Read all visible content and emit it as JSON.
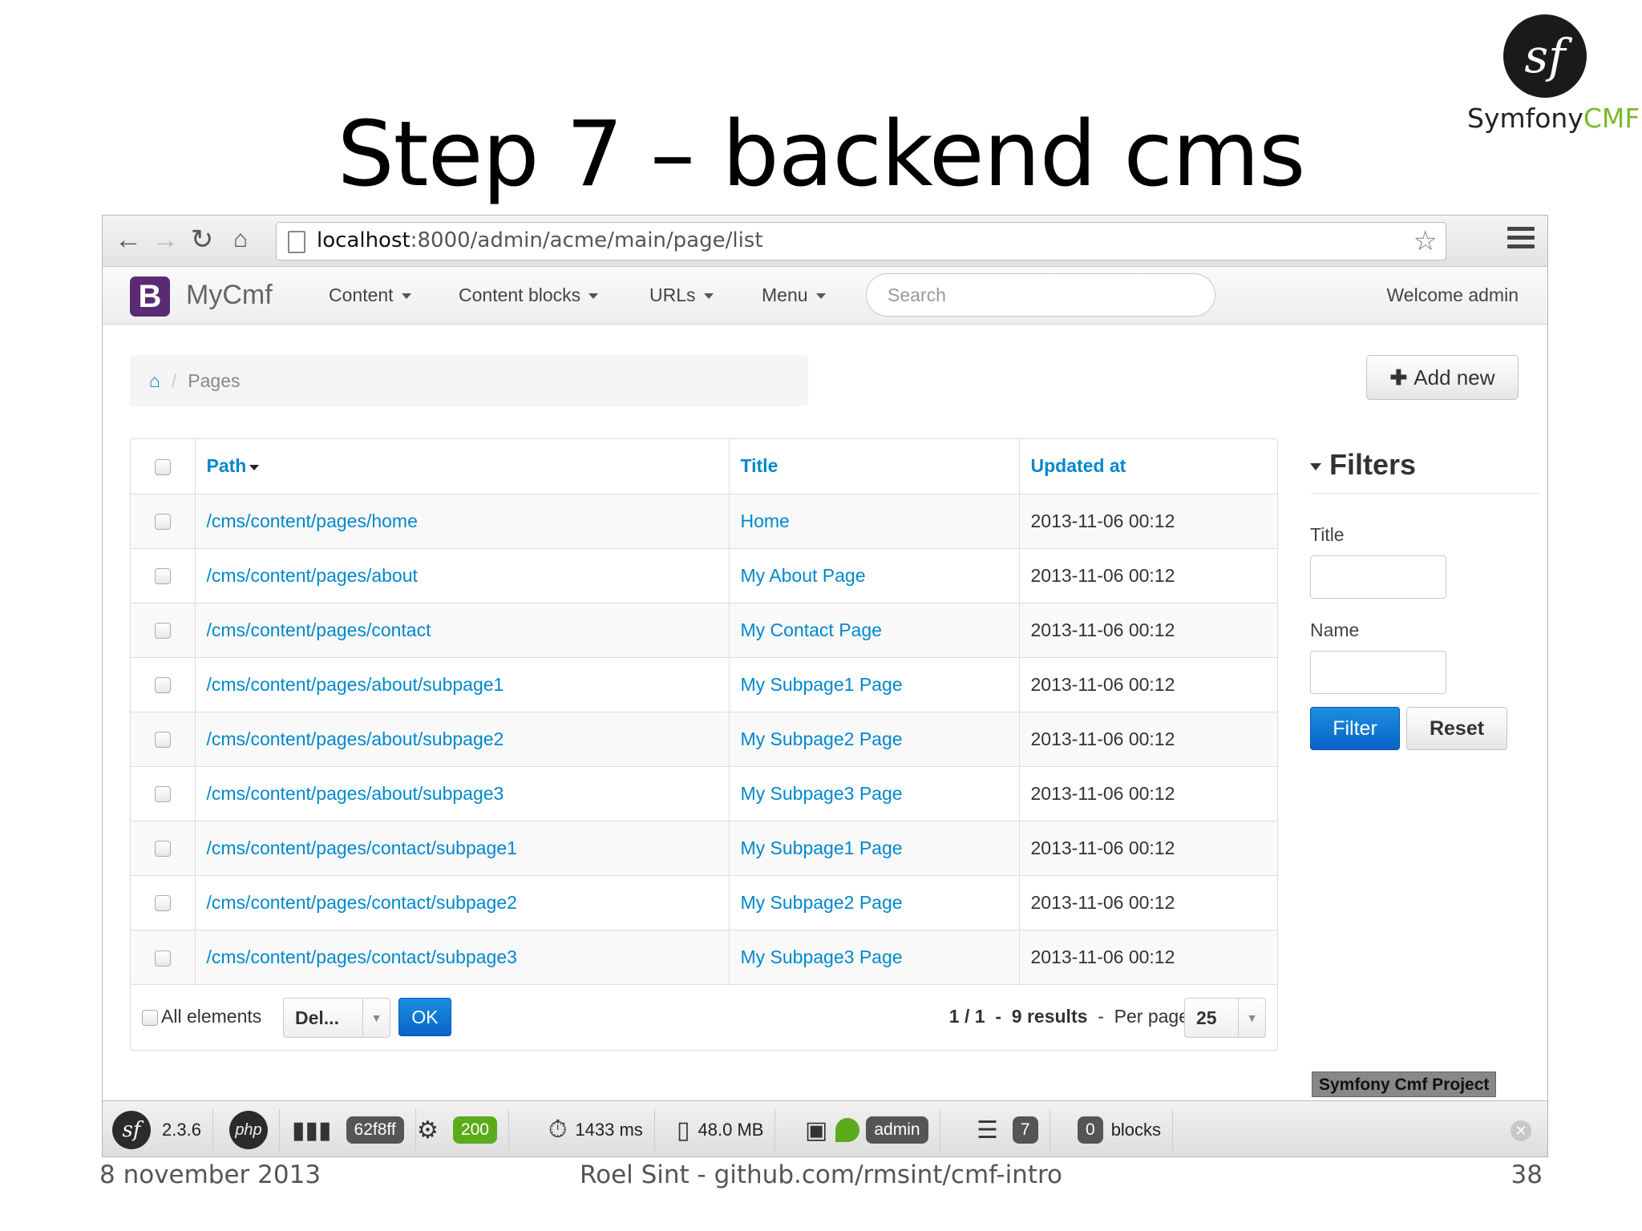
{
  "slide": {
    "title": "Step 7 – backend cms",
    "logo_text_1": "Symfony",
    "logo_text_2": "CMF",
    "logo_mark": "sf",
    "footer_date": "8 november 2013",
    "footer_author": "Roel Sint - github.com/rmsint/cmf-intro",
    "page_number": "38"
  },
  "browser": {
    "url_host": "localhost",
    "url_rest": ":8000/admin/acme/main/page/list",
    "icons": [
      "back-arrow-icon",
      "forward-arrow-icon",
      "reload-icon",
      "home-icon",
      "page-icon",
      "star-icon",
      "menu-icon"
    ]
  },
  "appnav": {
    "brand_letter": "B",
    "brand_name": "MyCmf",
    "items": [
      "Content",
      "Content blocks",
      "URLs",
      "Menu"
    ],
    "search_placeholder": "Search",
    "welcome": "Welcome admin"
  },
  "breadcrumb": {
    "home_icon": "⌂",
    "separator": "/",
    "current": "Pages"
  },
  "actions": {
    "add_new": "Add new"
  },
  "table": {
    "headers": {
      "path": "Path",
      "title": "Title",
      "updated": "Updated at"
    },
    "rows": [
      {
        "path": "/cms/content/pages/home",
        "title": "Home",
        "updated": "2013-11-06 00:12"
      },
      {
        "path": "/cms/content/pages/about",
        "title": "My About Page",
        "updated": "2013-11-06 00:12"
      },
      {
        "path": "/cms/content/pages/contact",
        "title": "My Contact Page",
        "updated": "2013-11-06 00:12"
      },
      {
        "path": "/cms/content/pages/about/subpage1",
        "title": "My Subpage1 Page",
        "updated": "2013-11-06 00:12"
      },
      {
        "path": "/cms/content/pages/about/subpage2",
        "title": "My Subpage2 Page",
        "updated": "2013-11-06 00:12"
      },
      {
        "path": "/cms/content/pages/about/subpage3",
        "title": "My Subpage3 Page",
        "updated": "2013-11-06 00:12"
      },
      {
        "path": "/cms/content/pages/contact/subpage1",
        "title": "My Subpage1 Page",
        "updated": "2013-11-06 00:12"
      },
      {
        "path": "/cms/content/pages/contact/subpage2",
        "title": "My Subpage2 Page",
        "updated": "2013-11-06 00:12"
      },
      {
        "path": "/cms/content/pages/contact/subpage3",
        "title": "My Subpage3 Page",
        "updated": "2013-11-06 00:12"
      }
    ],
    "footer": {
      "all_elements": "All elements",
      "batch_action": "Del...",
      "ok": "OK",
      "page_info": "1 / 1",
      "dash": "-",
      "results": "9 results",
      "per_page_label": "Per page",
      "per_page_value": "25"
    }
  },
  "filters": {
    "heading": "Filters",
    "title_label": "Title",
    "name_label": "Name",
    "filter_button": "Filter",
    "reset_button": "Reset"
  },
  "project_tag": "Symfony Cmf Project",
  "sfbar": {
    "version": "2.3.6",
    "php": "php",
    "token": "62f8ff",
    "status": "200",
    "time": "1433 ms",
    "memory": "48.0 MB",
    "user": "admin",
    "queries": "7",
    "blocks_count": "0",
    "blocks_label": "blocks",
    "colors": {
      "status_green": "#5cab1a",
      "link_blue": "#0088cc",
      "primary_blue": "#0a63c8"
    }
  }
}
